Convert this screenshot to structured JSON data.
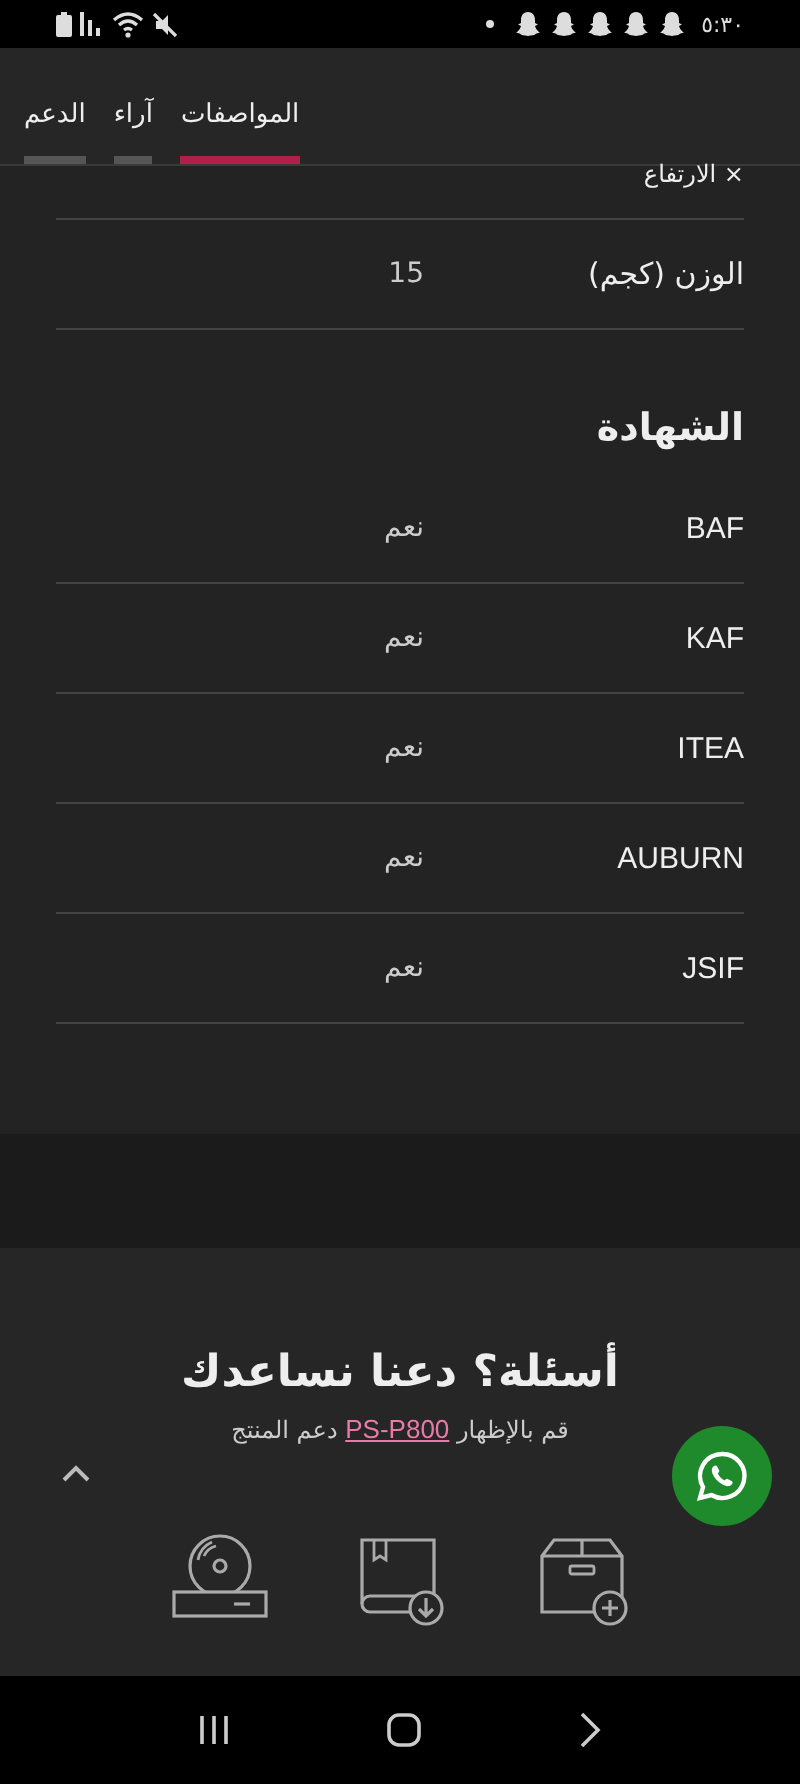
{
  "status_bar": {
    "time": "٥:٣٠"
  },
  "tabs": [
    {
      "label": "المواصفات",
      "selected": true
    },
    {
      "label": "آراء",
      "selected": false
    },
    {
      "label": "الدعم",
      "selected": false
    }
  ],
  "cut_off_spec_label": "× الارتفاع",
  "specs": [
    {
      "label": "الوزن (كجم)",
      "value": "15"
    }
  ],
  "certification": {
    "heading": "الشهادة",
    "rows": [
      {
        "label": "BAF",
        "value": "نعم"
      },
      {
        "label": "KAF",
        "value": "نعم"
      },
      {
        "label": "ITEA",
        "value": "نعم"
      },
      {
        "label": "AUBURN",
        "value": "نعم"
      },
      {
        "label": "JSIF",
        "value": "نعم"
      }
    ]
  },
  "help": {
    "title": "أسئلة؟ دعنا نساعدك",
    "prefix": "قم بالإظهار",
    "link": "PS-P800",
    "suffix": "دعم المنتج"
  }
}
